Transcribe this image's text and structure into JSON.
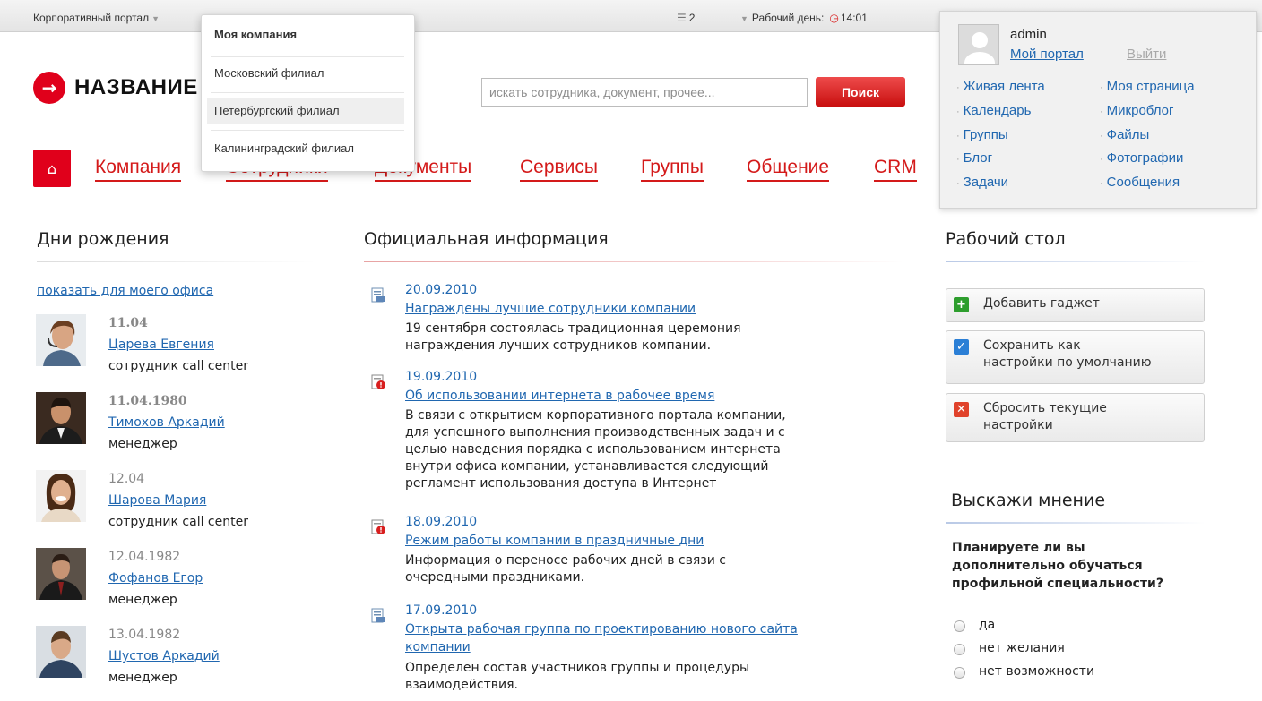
{
  "topbar": {
    "portal_label": "Корпоративный портал",
    "tasks_count": "2",
    "workday_label": "Рабочий день:",
    "time": "14:01"
  },
  "logo": {
    "text": "НАЗВАНИЕ"
  },
  "search": {
    "placeholder": "искать сотрудника, документ, прочее...",
    "button": "Поиск"
  },
  "nav": {
    "items": [
      "Компания",
      "Сотрудники",
      "Документы",
      "Сервисы",
      "Группы",
      "Общение",
      "CRM"
    ]
  },
  "dropdown": {
    "items": [
      {
        "label": "Моя компания",
        "header": true
      },
      {
        "label": "Московский филиал"
      },
      {
        "label": "Петербургский филиал",
        "selected": true
      },
      {
        "label": "Калининградский филиал"
      }
    ]
  },
  "user": {
    "name": "admin",
    "my_portal": "Мой портал",
    "logout": "Выйти",
    "links_left": [
      "Живая лента",
      "Календарь",
      "Группы",
      "Блог",
      "Задачи"
    ],
    "links_right": [
      "Моя страница",
      "Микроблог",
      "Файлы",
      "Фотографии",
      "Сообщения"
    ]
  },
  "birthdays": {
    "title": "Дни рождения",
    "show_office": "показать для моего офиса",
    "people": [
      {
        "date": "11.04",
        "name": "Царева Евгения",
        "role": "сотрудник call center",
        "bold": true
      },
      {
        "date": "11.04.1980",
        "name": "Тимохов Аркадий",
        "role": "менеджер",
        "bold": true
      },
      {
        "date": "12.04",
        "name": "Шарова Мария",
        "role": "сотрудник call center",
        "bold": false
      },
      {
        "date": "12.04.1982",
        "name": "Фофанов Егор",
        "role": "менеджер",
        "bold": false
      },
      {
        "date": "13.04.1982",
        "name": "Шустов Аркадий",
        "role": "менеджер",
        "bold": false
      }
    ]
  },
  "news": {
    "title": "Официальная информация",
    "items": [
      {
        "date": "20.09.2010",
        "title": "Награждены лучшие сотрудники компании",
        "title2": "",
        "text": "19 сентября состоялась традиционная церемония\nнаграждения лучших сотрудников компании.",
        "icon": "document-icon"
      },
      {
        "date": "19.09.2010",
        "title": "Об использовании интернета в рабочее время",
        "title2": "",
        "text": "В связи с открытием корпоративного портала компании,\nдля успешного выполнения производственных задач и с\nцелью наведения порядка с использованием интернета\nвнутри офиса компании, устанавливается следующий\nрегламент использования доступа в Интернет",
        "icon": "important-document-icon"
      },
      {
        "date": "18.09.2010",
        "title": "Режим работы компании в праздничные дни",
        "title2": "",
        "text": "Информация о переносе рабочих дней в связи с\nочередными праздниками.",
        "icon": "important-document-icon"
      },
      {
        "date": "17.09.2010",
        "title": "Открыта рабочая группа по проектированию нового сайта",
        "title2": "компании",
        "text": "Определен состав участников группы и процедуры\nвзаимодействия.",
        "icon": "document-icon"
      }
    ]
  },
  "desktop": {
    "title": "Рабочий стол",
    "buttons": [
      {
        "label": "Добавить гаджет",
        "icon": "plus-icon",
        "color": "#2e9e2e"
      },
      {
        "label": "Сохранить как\nнастройки по умолчанию",
        "icon": "check-icon",
        "color": "#2b7fd6"
      },
      {
        "label": "Сбросить текущие\nнастройки",
        "icon": "x-icon",
        "color": "#e0422b"
      }
    ]
  },
  "poll": {
    "title": "Выскажи мнение",
    "question": "Планируете ли вы\nдополнительно обучаться\nпрофильной специальности?",
    "options": [
      "да",
      "нет желания",
      "нет возможности"
    ]
  },
  "colors": {
    "accent": "#e0001b",
    "link": "#2067b0"
  }
}
